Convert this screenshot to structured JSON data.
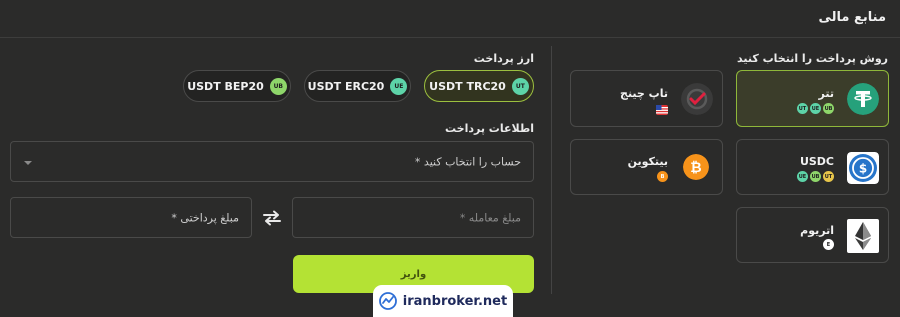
{
  "header": {
    "title": "منابع مالی"
  },
  "payment_methods": {
    "label": "روش پرداخت را انتخاب کنید",
    "items": [
      {
        "name": "تتر",
        "icon": "tether-icon",
        "color": "#26a17b",
        "badges": [
          "UB",
          "UE",
          "UT"
        ],
        "selected": true
      },
      {
        "name": "تاپ چینج",
        "icon": "topchange-icon",
        "color": "#e0203f",
        "badges": [
          "us-flag"
        ],
        "selected": false
      },
      {
        "name": "USDC",
        "icon": "usdc-icon",
        "color": "#2775ca",
        "badges": [
          "UT",
          "UB",
          "UE"
        ],
        "selected": false
      },
      {
        "name": "بیتکوین",
        "icon": "bitcoin-icon",
        "color": "#f7931a",
        "badges": [
          "B"
        ],
        "selected": false
      },
      {
        "name": "اتریوم",
        "icon": "ethereum-icon",
        "color": "#ffffff",
        "badges": [
          "E"
        ],
        "selected": false
      }
    ]
  },
  "currency": {
    "label": "ارز پرداخت",
    "options": [
      {
        "label": "USDT TRC20",
        "tag": "UT",
        "tag_color": "#5dd3a8",
        "selected": true
      },
      {
        "label": "USDT ERC20",
        "tag": "UE",
        "tag_color": "#5dd3a8",
        "selected": false
      },
      {
        "label": "USDT BEP20",
        "tag": "UB",
        "tag_color": "#8ed66a",
        "selected": false
      }
    ]
  },
  "payment_info": {
    "label": "اطلاعات پرداخت",
    "account_placeholder": "حساب را انتخاب کنید *",
    "trade_amount_placeholder": "مبلغ معامله *",
    "pay_amount_placeholder": "مبلغ پرداختی *"
  },
  "submit": {
    "label": "واریز"
  },
  "watermark": {
    "text": "iranbroker.net"
  },
  "colors": {
    "accent": "#b4e234",
    "background": "#2b2b2a"
  }
}
